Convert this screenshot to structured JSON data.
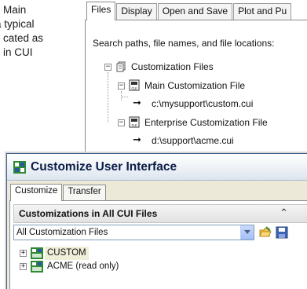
{
  "background_text": {
    "lines": [
      "Main",
      "a typical",
      "cated as",
      "in CUI"
    ]
  },
  "options_dialog": {
    "tabs": [
      "Files",
      "Display",
      "Open and Save",
      "Plot and Pu"
    ],
    "active_tab": "Files",
    "description": "Search paths, file names, and file locations:",
    "tree": {
      "root": "Customization Files",
      "main_label": "Main Customization File",
      "main_path": "c:\\mysupport\\custom.cui",
      "enterprise_label": "Enterprise Customization File",
      "enterprise_path": "d:\\support\\acme.cui"
    }
  },
  "cui_window": {
    "title": "Customize User Interface",
    "tabs": [
      "Customize",
      "Transfer"
    ],
    "active_tab": "Customize",
    "section_title": "Customizations in All CUI Files",
    "collapse_icon": "double-chevron-up-icon",
    "dropdown_value": "All Customization Files",
    "tree": [
      {
        "label": "CUSTOM",
        "selected": true
      },
      {
        "label": "ACME (read only)",
        "selected": false
      }
    ]
  },
  "colors": {
    "title_text": "#0b1c46",
    "cui_icon_green": "#2d8a32",
    "cui_icon_blue": "#2b55a8"
  }
}
